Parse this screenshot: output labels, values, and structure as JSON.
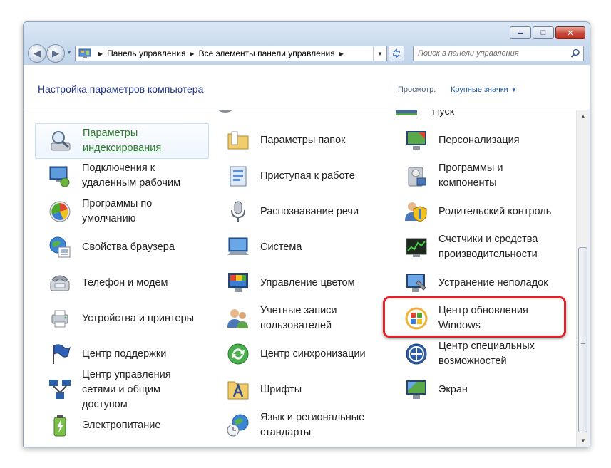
{
  "window": {
    "buttons": {
      "minimize": "▬",
      "maximize": "□",
      "close": "✕"
    }
  },
  "nav": {
    "breadcrumb": [
      "Панель управления",
      "Все элементы панели управления"
    ],
    "search_placeholder": "Поиск в панели управления"
  },
  "header": {
    "title": "Настройка параметров компьютера",
    "view_label": "Просмотр:",
    "view_value": "Крупные значки"
  },
  "items": {
    "col1": [
      {
        "label": "Параметры индексирования",
        "icon": "indexing-icon"
      },
      {
        "label": "Подключения к удаленным рабочим",
        "icon": "remote-desktop-icon"
      },
      {
        "label": "Программы по умолчанию",
        "icon": "default-programs-icon"
      },
      {
        "label": "Свойства браузера",
        "icon": "internet-options-icon"
      },
      {
        "label": "Телефон и модем",
        "icon": "phone-modem-icon"
      },
      {
        "label": "Устройства и принтеры",
        "icon": "devices-printers-icon"
      },
      {
        "label": "Центр поддержки",
        "icon": "action-center-flag-icon"
      },
      {
        "label": "Центр управления сетями и общим доступом",
        "icon": "network-center-icon"
      },
      {
        "label": "Электропитание",
        "icon": "power-options-icon"
      }
    ],
    "col2": [
      {
        "label": "Параметры папок",
        "icon": "folder-options-icon"
      },
      {
        "label": "Приступая к работе",
        "icon": "getting-started-icon"
      },
      {
        "label": "Распознавание речи",
        "icon": "microphone-icon"
      },
      {
        "label": "Система",
        "icon": "system-icon"
      },
      {
        "label": "Управление цветом",
        "icon": "color-management-icon"
      },
      {
        "label": "Учетные записи пользователей",
        "icon": "user-accounts-icon"
      },
      {
        "label": "Центр синхронизации",
        "icon": "sync-center-icon"
      },
      {
        "label": "Шрифты",
        "icon": "fonts-icon"
      },
      {
        "label": "Язык и региональные стандарты",
        "icon": "region-language-icon"
      }
    ],
    "col3": [
      {
        "label": "Персонализация",
        "icon": "personalization-icon"
      },
      {
        "label": "Программы и компоненты",
        "icon": "programs-features-icon"
      },
      {
        "label": "Родительский контроль",
        "icon": "parental-controls-icon"
      },
      {
        "label": "Счетчики и средства производительности",
        "icon": "performance-icon"
      },
      {
        "label": "Устранение неполадок",
        "icon": "troubleshooting-icon"
      },
      {
        "label": "Центр обновления Windows",
        "icon": "windows-update-icon"
      },
      {
        "label": "Центр специальных возможностей",
        "icon": "ease-of-access-icon"
      },
      {
        "label": "Экран",
        "icon": "display-icon"
      }
    ],
    "col3_partial_top": "Пуск"
  },
  "colors": {
    "header_title": "#1e3287",
    "link": "#1e57a5",
    "highlight": "#e0202a",
    "selected_label": "#2f7a2e"
  }
}
